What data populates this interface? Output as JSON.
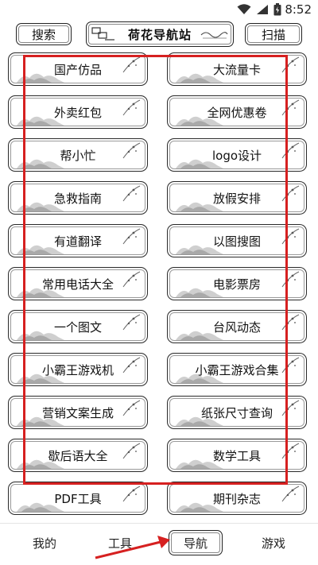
{
  "status_bar": {
    "time": "8:52",
    "icons": [
      "wifi-icon",
      "signal-icon",
      "battery-icon"
    ]
  },
  "header": {
    "search_label": "搜索",
    "title": "荷花导航站",
    "scan_label": "扫描"
  },
  "tiles": [
    "国产仿品",
    "大流量卡",
    "外卖红包",
    "全网优惠卷",
    "帮小忙",
    "logo设计",
    "急救指南",
    "放假安排",
    "有道翻译",
    "以图搜图",
    "常用电话大全",
    "电影票房",
    "一个图文",
    "台风动态",
    "小霸王游戏机",
    "小霸王游戏合集",
    "营销文案生成",
    "纸张尺寸查询",
    "歇后语大全",
    "数学工具",
    "PDF工具",
    "期刊杂志"
  ],
  "bottom_nav": {
    "mine": "我的",
    "tools": "工具",
    "nav": "导航",
    "games": "游戏"
  },
  "colors": {
    "highlight": "#d62020",
    "border": "#2a2a2a"
  }
}
